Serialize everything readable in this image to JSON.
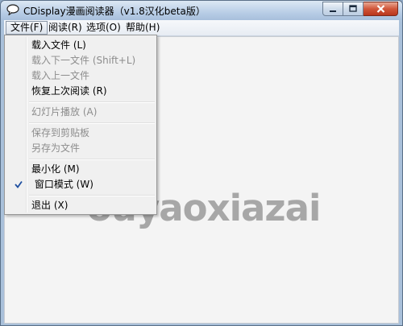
{
  "window": {
    "title": "CDisplay漫画阅读器（v1.8汉化beta版）",
    "icons": {
      "app": "speech-bubble-icon",
      "minimize": "minimize-icon",
      "maximize": "maximize-icon",
      "close": "close-icon"
    }
  },
  "menubar": {
    "items": [
      {
        "label": "文件(F)",
        "active": true
      },
      {
        "label": "阅读(R)"
      },
      {
        "label": "选项(O)"
      },
      {
        "label": "帮助(H)"
      }
    ]
  },
  "file_menu": {
    "items": [
      {
        "label": "载入文件 (L)",
        "enabled": true
      },
      {
        "label": "载入下一文件 (Shift+L)",
        "enabled": false
      },
      {
        "label": "载入上一文件",
        "enabled": false
      },
      {
        "label": "恢复上次阅读 (R)",
        "enabled": true
      },
      {
        "label": "幻灯片播放 (A)",
        "enabled": false
      },
      {
        "label": "保存到剪贴板",
        "enabled": false
      },
      {
        "label": "另存为文件",
        "enabled": false
      },
      {
        "label": "最小化 (M)",
        "enabled": true
      },
      {
        "label": "窗口模式 (W)",
        "enabled": true,
        "checked": true
      },
      {
        "label": "退出 (X)",
        "enabled": true
      }
    ]
  },
  "watermark": "ouyaoxiazai",
  "colors": {
    "title_bar": "#b9cee6",
    "close_button": "#d0563a",
    "menu_background": "#f0f0f0",
    "disabled_text": "#8d8d8d"
  }
}
